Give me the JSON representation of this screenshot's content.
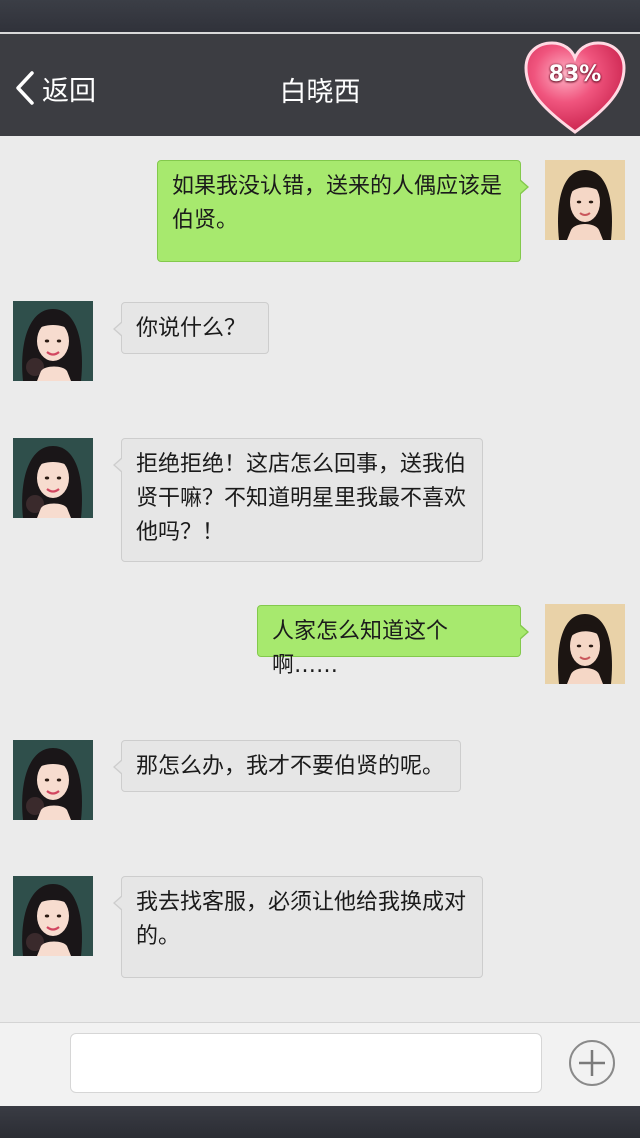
{
  "header": {
    "back_label": "返回",
    "title": "白晓西",
    "affection": "83%"
  },
  "messages": [
    {
      "side": "out",
      "text": "如果我没认错，送来的人偶应该是伯贤。"
    },
    {
      "side": "in",
      "text": "你说什么？"
    },
    {
      "side": "in",
      "text": "拒绝拒绝！这店怎么回事，送我伯贤干嘛？不知道明星里我最不喜欢他吗？！"
    },
    {
      "side": "out",
      "text": "人家怎么知道这个啊……"
    },
    {
      "side": "in",
      "text": "那怎么办，我才不要伯贤的呢。"
    },
    {
      "side": "in",
      "text": "我去找客服，必须让他给我换成对的。"
    }
  ],
  "input": {
    "value": "",
    "placeholder": ""
  },
  "icons": {
    "back": "chevron-left-icon",
    "affection": "heart-icon",
    "add": "plus-circle-icon"
  },
  "colors": {
    "header_bg": "#3c3d42",
    "chat_bg": "#ebebeb",
    "out_bubble": "#a7e96e",
    "in_bubble": "#e6e6e6",
    "heart": "#e8436f"
  }
}
